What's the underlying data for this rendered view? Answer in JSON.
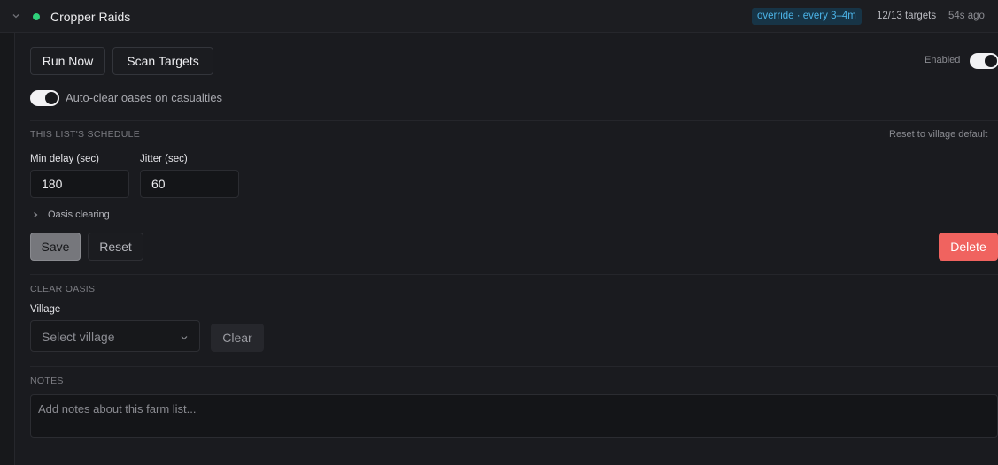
{
  "header": {
    "title": "Cropper Raids",
    "badge": "override · every 3–4m",
    "targets": "12/13 targets",
    "updated": "54s ago",
    "status_color": "#2fd07a"
  },
  "actions": {
    "run_now": "Run Now",
    "scan_targets": "Scan Targets",
    "enabled_label": "Enabled",
    "enabled": true
  },
  "auto_clear": {
    "label": "Auto-clear oases on casualties",
    "enabled": true
  },
  "schedule": {
    "section_title": "THIS LIST'S SCHEDULE",
    "reset_default": "Reset to village default",
    "min_delay_label": "Min delay (sec)",
    "min_delay_value": "180",
    "jitter_label": "Jitter (sec)",
    "jitter_value": "60",
    "oasis_clearing": "Oasis clearing",
    "save": "Save",
    "reset": "Reset",
    "delete": "Delete"
  },
  "clear_oasis": {
    "section_title": "CLEAR OASIS",
    "village_label": "Village",
    "village_placeholder": "Select village",
    "clear": "Clear"
  },
  "notes": {
    "section_title": "NOTES",
    "placeholder": "Add notes about this farm list..."
  },
  "colors": {
    "accent_badge": "#4cb4e8",
    "delete": "#f0635f"
  }
}
